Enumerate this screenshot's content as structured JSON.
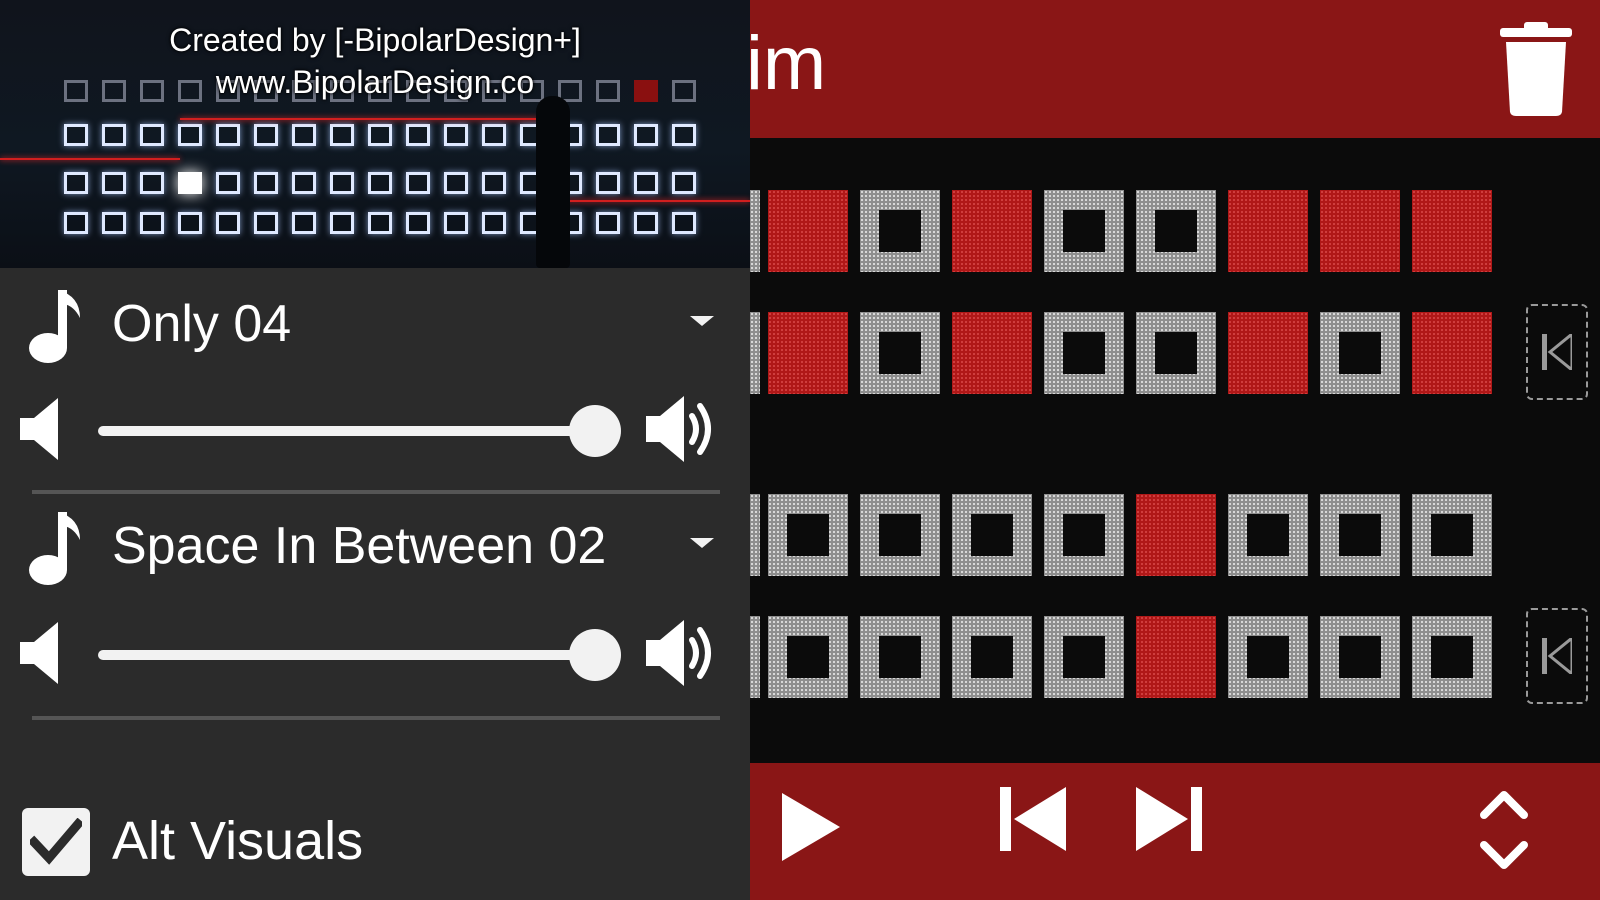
{
  "app": {
    "title_visible": "im"
  },
  "banner": {
    "credit_line1": "Created by [-BipolarDesign+]",
    "credit_line2": "www.BipolarDesign.co"
  },
  "tracks": [
    {
      "name": "Only 04",
      "volume_fraction": 0.97
    },
    {
      "name": "Space In Between 02",
      "volume_fraction": 0.97
    }
  ],
  "alt_visuals": {
    "label": "Alt Visuals",
    "checked": true
  },
  "grid": {
    "rows": [
      {
        "cells": [
          "on",
          "off",
          "on",
          "off",
          "off",
          "on",
          "on",
          "on"
        ],
        "jump_marker": false
      },
      {
        "cells": [
          "on",
          "off",
          "on",
          "off",
          "off",
          "on",
          "off",
          "on"
        ],
        "jump_marker": true
      },
      {
        "cells": [],
        "jump_marker": false
      },
      {
        "cells": [
          "off",
          "off",
          "off",
          "off",
          "on",
          "off",
          "off",
          "off"
        ],
        "jump_marker": false
      },
      {
        "cells": [
          "off",
          "off",
          "off",
          "off",
          "on",
          "off",
          "off",
          "off"
        ],
        "jump_marker": true
      }
    ]
  },
  "icons": {
    "trash": "trash-icon",
    "play": "play-icon",
    "previous": "skip-previous-icon",
    "next": "skip-next-icon",
    "expand": "expand-collapse-icon",
    "note": "music-note-icon",
    "vol_low": "volume-low-icon",
    "vol_high": "volume-high-icon",
    "check": "check-icon",
    "dropdown": "dropdown-caret-icon",
    "jump": "jump-to-start-icon"
  },
  "colors": {
    "accent_red": "#8a1616",
    "cell_red": "#b01818",
    "panel_gray": "#2b2b2b"
  }
}
